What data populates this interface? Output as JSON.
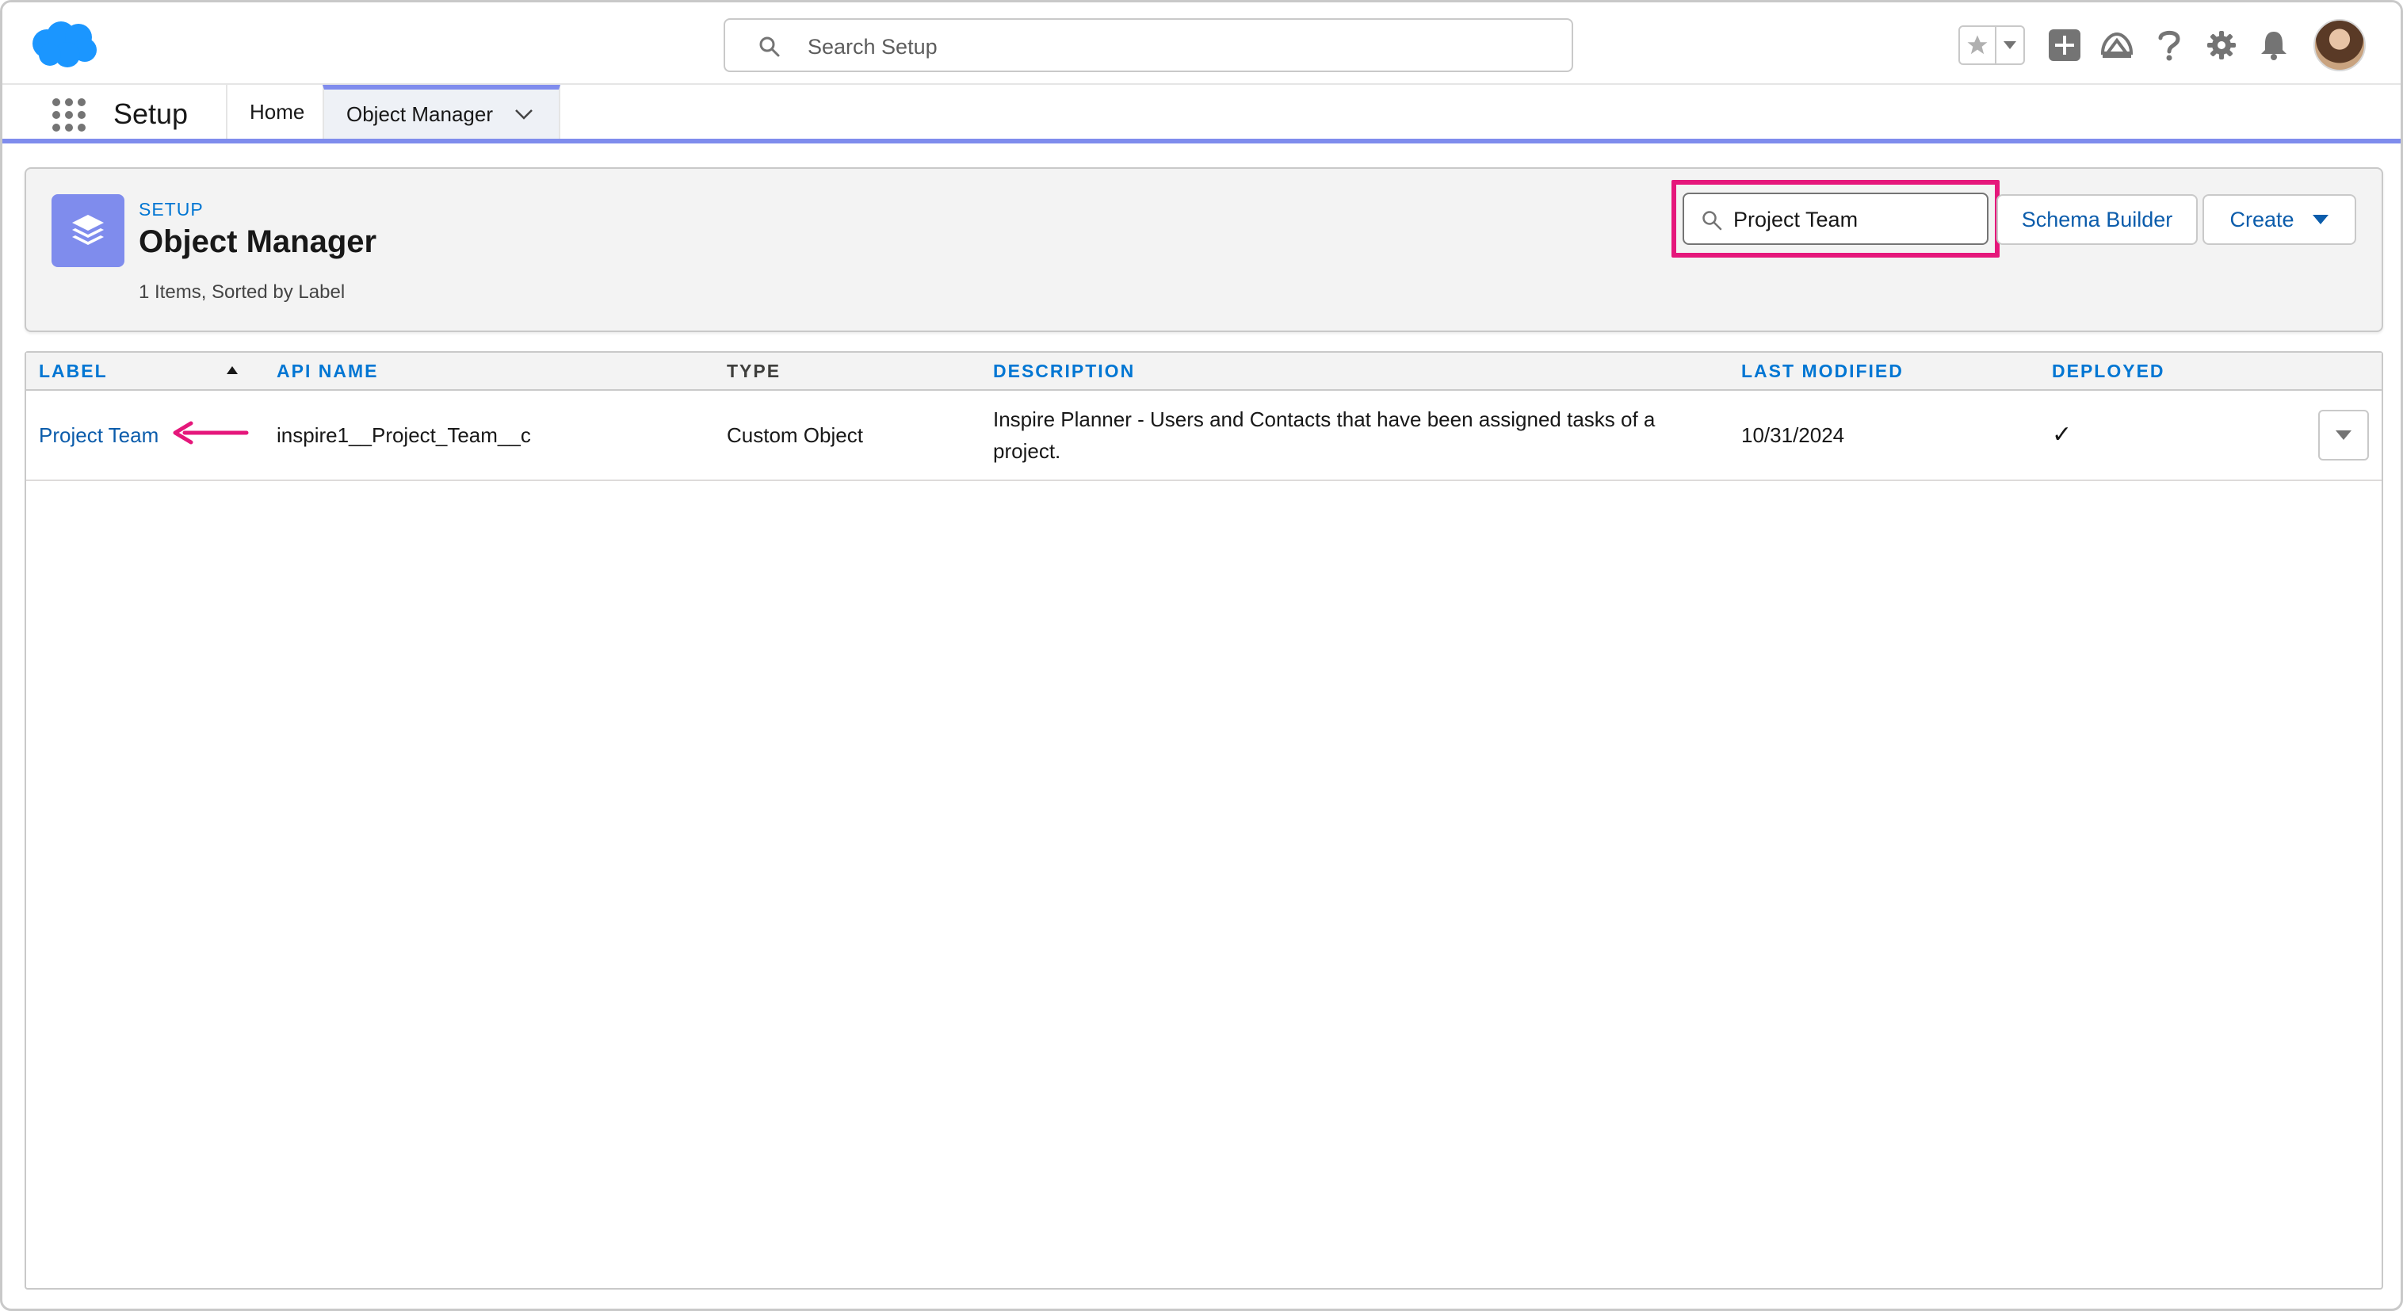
{
  "header": {
    "search_placeholder": "Search Setup",
    "icons": [
      "cloud-logo-icon",
      "star-icon",
      "chevron-down-icon",
      "add-icon",
      "trailhead-icon",
      "help-icon",
      "gear-icon",
      "bell-icon",
      "avatar"
    ]
  },
  "nav": {
    "app_name": "Setup",
    "tabs": [
      {
        "label": "Home"
      },
      {
        "label": "Object Manager"
      }
    ]
  },
  "object_manager": {
    "eyebrow": "SETUP",
    "title": "Object Manager",
    "subtitle": "1 Items, Sorted by Label",
    "quick_find_value": "Project Team",
    "schema_builder_label": "Schema Builder",
    "create_label": "Create"
  },
  "table": {
    "columns": [
      "LABEL",
      "API NAME",
      "TYPE",
      "DESCRIPTION",
      "LAST MODIFIED",
      "DEPLOYED"
    ],
    "rows": [
      {
        "label": "Project Team",
        "api_name": "inspire1__Project_Team__c",
        "type": "Custom Object",
        "description_line1": "Inspire Planner - Users and Contacts that have been assigned tasks of a",
        "description_line2": "project.",
        "last_modified": "10/31/2024",
        "deployed": "✓"
      }
    ]
  },
  "colors": {
    "brand_blue": "#0176d3",
    "link_blue": "#0b5cab",
    "nav_accent": "#7f8ced",
    "highlight_pink": "#e5177b",
    "salesforce_cloud": "#1b96ff"
  }
}
